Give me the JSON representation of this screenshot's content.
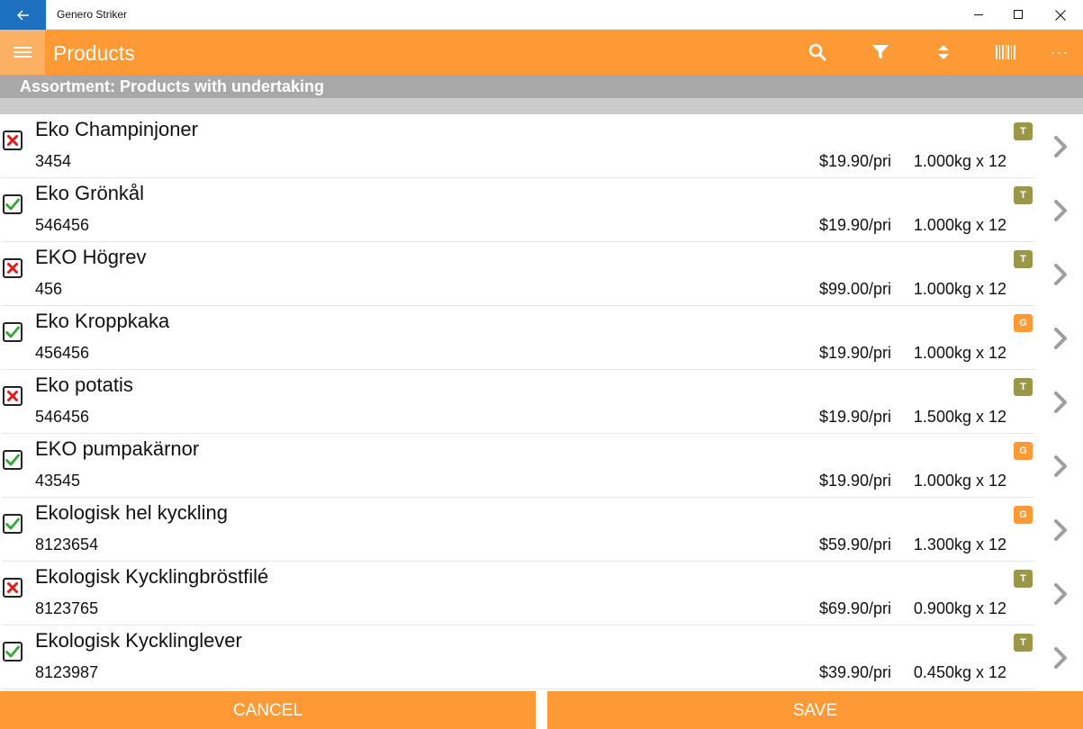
{
  "window": {
    "title": "Genero Striker"
  },
  "appbar": {
    "title": "Products"
  },
  "assortment_label": "Assortment: Products with undertaking",
  "colors": {
    "accent": "#fd9a35",
    "titlebar_back": "#1d6fc0",
    "badge_T": "#9a9848",
    "badge_G": "#fd9a35"
  },
  "products": [
    {
      "name": "Eko Champinjoner",
      "code": "3454",
      "price": "$19.90/pri",
      "pack": "1.000kg x 12",
      "status": "unchecked",
      "badge": "T"
    },
    {
      "name": "Eko Grönkål",
      "code": "546456",
      "price": "$19.90/pri",
      "pack": "1.000kg x 12",
      "status": "checked",
      "badge": "T"
    },
    {
      "name": "EKO Högrev",
      "code": "456",
      "price": "$99.00/pri",
      "pack": "1.000kg x 12",
      "status": "unchecked",
      "badge": "T"
    },
    {
      "name": "Eko Kroppkaka",
      "code": "456456",
      "price": "$19.90/pri",
      "pack": "1.000kg x 12",
      "status": "checked",
      "badge": "G"
    },
    {
      "name": "Eko potatis",
      "code": "546456",
      "price": "$19.90/pri",
      "pack": "1.500kg x 12",
      "status": "unchecked",
      "badge": "T"
    },
    {
      "name": "EKO pumpakärnor",
      "code": "43545",
      "price": "$19.90/pri",
      "pack": "1.000kg x 12",
      "status": "checked",
      "badge": "G"
    },
    {
      "name": "Ekologisk hel kyckling",
      "code": "8123654",
      "price": "$59.90/pri",
      "pack": "1.300kg x 12",
      "status": "checked",
      "badge": "G"
    },
    {
      "name": "Ekologisk Kycklingbröstfilé",
      "code": "8123765",
      "price": "$69.90/pri",
      "pack": "0.900kg x 12",
      "status": "unchecked",
      "badge": "T"
    },
    {
      "name": "Ekologisk Kycklinglever",
      "code": "8123987",
      "price": "$39.90/pri",
      "pack": "0.450kg x 12",
      "status": "checked",
      "badge": "T"
    }
  ],
  "buttons": {
    "cancel": "CANCEL",
    "save": "SAVE"
  }
}
